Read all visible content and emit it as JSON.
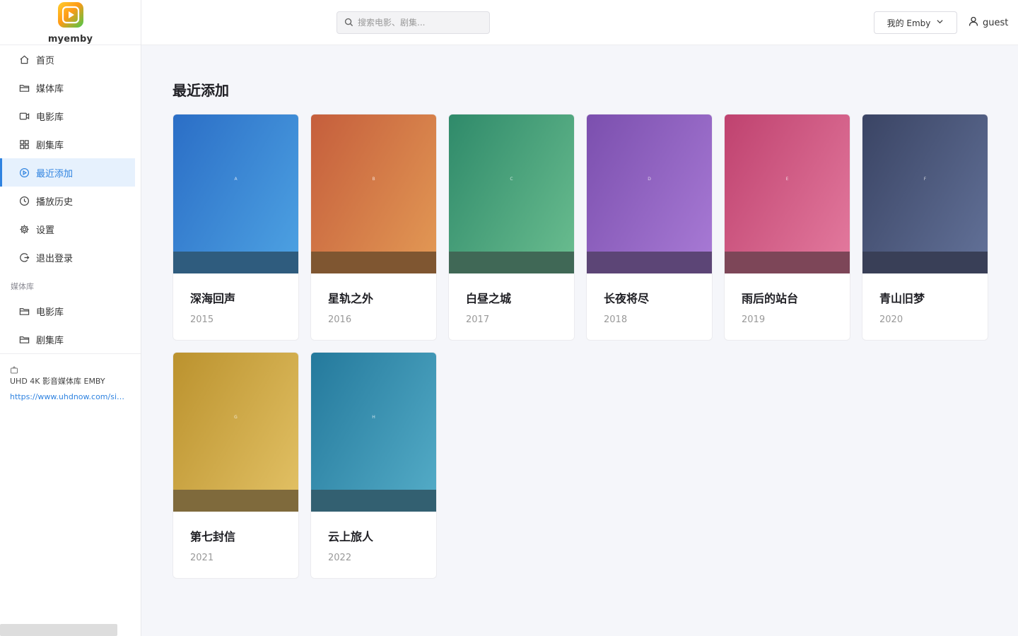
{
  "brand": {
    "name": "myemby"
  },
  "nav": {
    "items": [
      {
        "label": "首页",
        "icon": "home-icon"
      },
      {
        "label": "媒体库",
        "icon": "folder-icon"
      },
      {
        "label": "电影库",
        "icon": "video-icon"
      },
      {
        "label": "剧集库",
        "icon": "grid-icon"
      },
      {
        "label": "最近添加",
        "icon": "play-circle-icon",
        "active": true
      },
      {
        "label": "播放历史",
        "icon": "history-icon"
      },
      {
        "label": "设置",
        "icon": "gear-icon"
      },
      {
        "label": "退出登录",
        "icon": "logout-icon"
      }
    ]
  },
  "library_section": {
    "title": "媒体库",
    "items": [
      {
        "label": "电影库",
        "icon": "folder-icon"
      },
      {
        "label": "剧集库",
        "icon": "folder-icon"
      }
    ]
  },
  "footer": {
    "icon": "server-icon",
    "title": "UHD 4K 影音媒体库 EMBY",
    "link": "https://www.uhdnow.com/sig..."
  },
  "header": {
    "search_placeholder": "搜索电影、剧集...",
    "server_select": "我的 Emby",
    "user": "guest"
  },
  "page": {
    "title": "最近添加"
  },
  "cards": [
    {
      "title": "深海回声",
      "year": "2015",
      "letter": "A",
      "colors": [
        "#2b6ec6",
        "#4ea3e3"
      ],
      "strip": "#2f5c7e"
    },
    {
      "title": "星轨之外",
      "year": "2016",
      "letter": "B",
      "colors": [
        "#c55e3c",
        "#e39a55"
      ],
      "strip": "#7f5631"
    },
    {
      "title": "白昼之城",
      "year": "2017",
      "letter": "C",
      "colors": [
        "#2f8a6a",
        "#6bbe90"
      ],
      "strip": "#406856"
    },
    {
      "title": "长夜将尽",
      "year": "2018",
      "letter": "D",
      "colors": [
        "#7b4fae",
        "#a97bd6"
      ],
      "strip": "#5c4576"
    },
    {
      "title": "雨后的站台",
      "year": "2019",
      "letter": "E",
      "colors": [
        "#bf426f",
        "#e47b9f"
      ],
      "strip": "#7d4658"
    },
    {
      "title": "青山旧梦",
      "year": "2020",
      "letter": "F",
      "colors": [
        "#3a4464",
        "#637299"
      ],
      "strip": "#393f57"
    },
    {
      "title": "第七封信",
      "year": "2021",
      "letter": "G",
      "colors": [
        "#bb922e",
        "#e3c266"
      ],
      "strip": "#7f6a3c"
    },
    {
      "title": "云上旅人",
      "year": "2022",
      "letter": "H",
      "colors": [
        "#24799c",
        "#55adc8"
      ],
      "strip": "#336071"
    }
  ]
}
